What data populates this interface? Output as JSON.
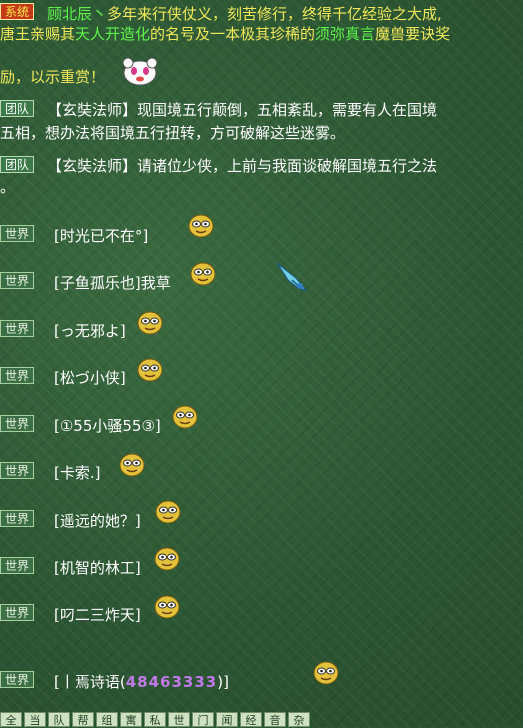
{
  "system": {
    "tag": "系统",
    "line1": {
      "player": "顾北辰丶",
      "rest": "多年来行侠仗义，刻苦修行，终得千亿经验之大成,"
    },
    "line2": {
      "a": "唐王亲赐其",
      "title": "天人开造化",
      "b": "的名号及一本极其珍稀的",
      "item": "须弥真言",
      "c": "魔兽要诀奖"
    },
    "line3": "励，以示重赏！"
  },
  "team_messages": [
    {
      "tag": "团队",
      "speaker": "【玄奘法师】",
      "text1": "现国境五行颠倒，五相紊乱，需要有人在国境",
      "text2": "五相，想办法将国境五行扭转，方可破解这些迷雾。"
    },
    {
      "tag": "团队",
      "speaker": "【玄奘法师】",
      "text1": "请诸位少侠，上前与我面谈破解国境五行之法",
      "text2": "。"
    }
  ],
  "world_messages": [
    {
      "tag": "世界",
      "name": "[时光已不在°]"
    },
    {
      "tag": "世界",
      "name": "[子鱼孤乐也]我草"
    },
    {
      "tag": "世界",
      "name": "[っ无邪よ]"
    },
    {
      "tag": "世界",
      "name": "[松づ小侠]"
    },
    {
      "tag": "世界",
      "name": "[①55小骚55③]"
    },
    {
      "tag": "世界",
      "name": "[卡索.]"
    },
    {
      "tag": "世界",
      "name": "[遥远的她？]"
    },
    {
      "tag": "世界",
      "name": "[机智的林工]"
    },
    {
      "tag": "世界",
      "name": "[叼二三炸天]"
    },
    {
      "tag": "世界",
      "name_prefix": "[丨焉诗语(",
      "name_number": "48463333",
      "name_suffix": ")]"
    }
  ],
  "bottom_bar": [
    "全",
    "当",
    "队",
    "帮",
    "组",
    "寓",
    "私",
    "世",
    "门",
    "闻",
    "经",
    "音",
    "杂"
  ]
}
